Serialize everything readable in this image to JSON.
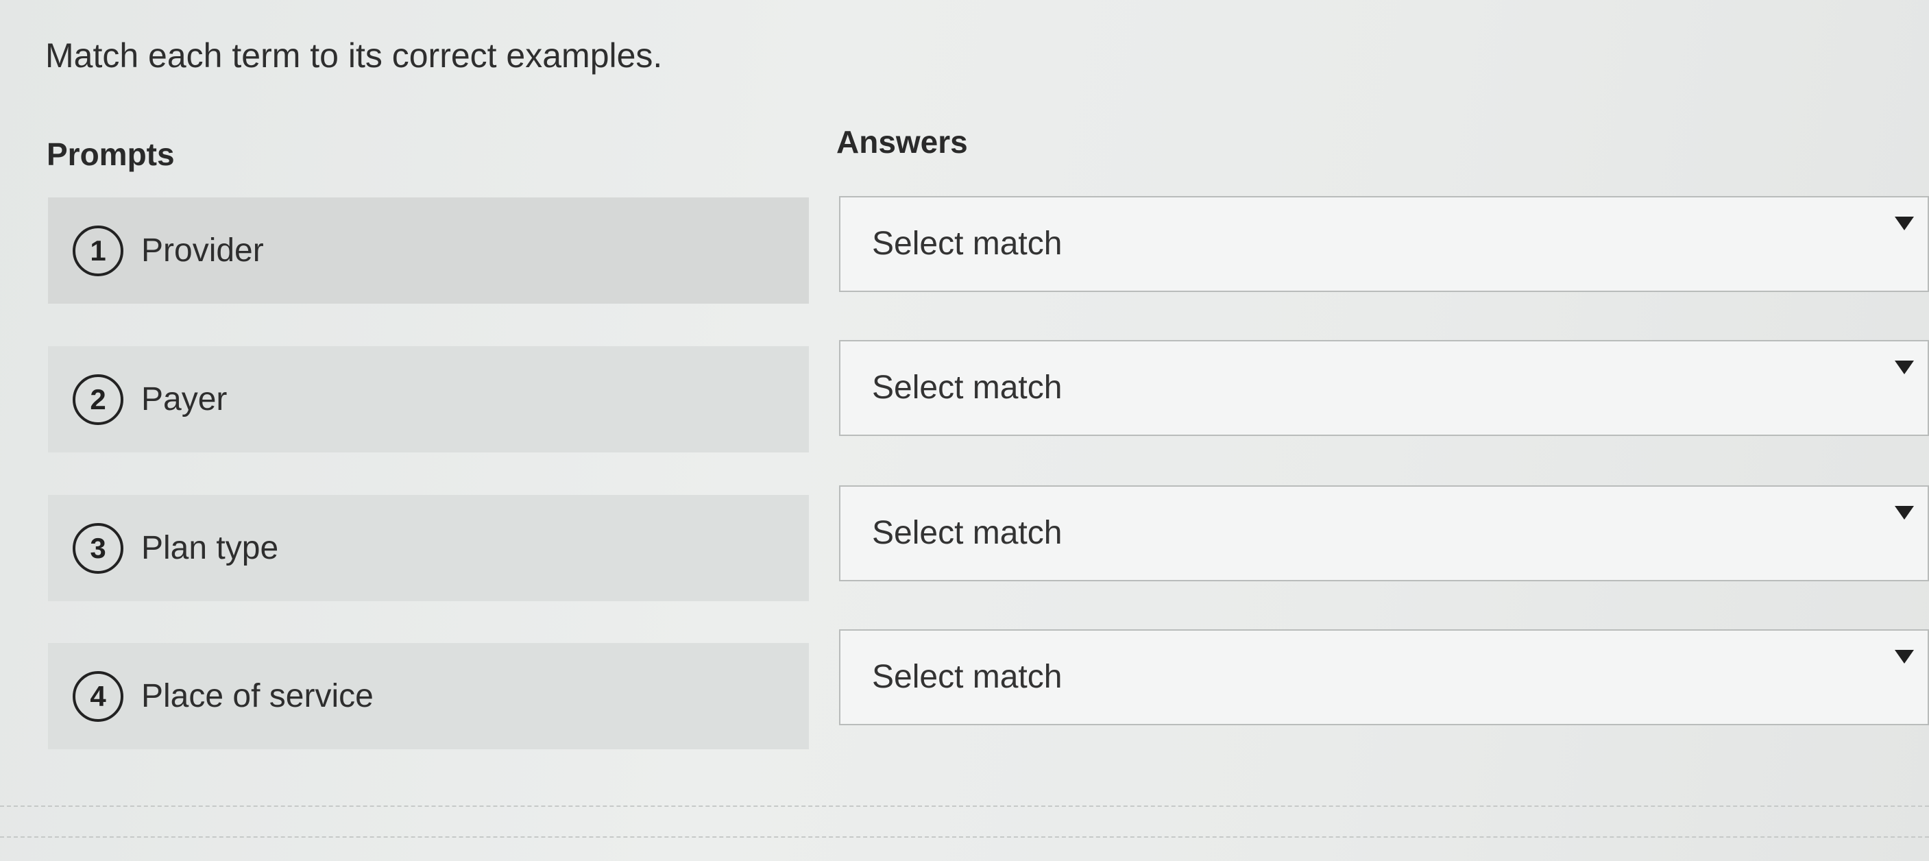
{
  "instruction": "Match each term to its correct examples.",
  "headings": {
    "prompts": "Prompts",
    "answers": "Answers"
  },
  "prompts": [
    {
      "number": "1",
      "label": "Provider"
    },
    {
      "number": "2",
      "label": "Payer"
    },
    {
      "number": "3",
      "label": "Plan type"
    },
    {
      "number": "4",
      "label": "Place of service"
    }
  ],
  "answers": [
    {
      "placeholder": "Select match",
      "icon": "caret-down-icon"
    },
    {
      "placeholder": "Select match",
      "icon": "caret-down-icon"
    },
    {
      "placeholder": "Select match",
      "icon": "caret-down-icon"
    },
    {
      "placeholder": "Select match",
      "icon": "caret-down-icon"
    }
  ]
}
